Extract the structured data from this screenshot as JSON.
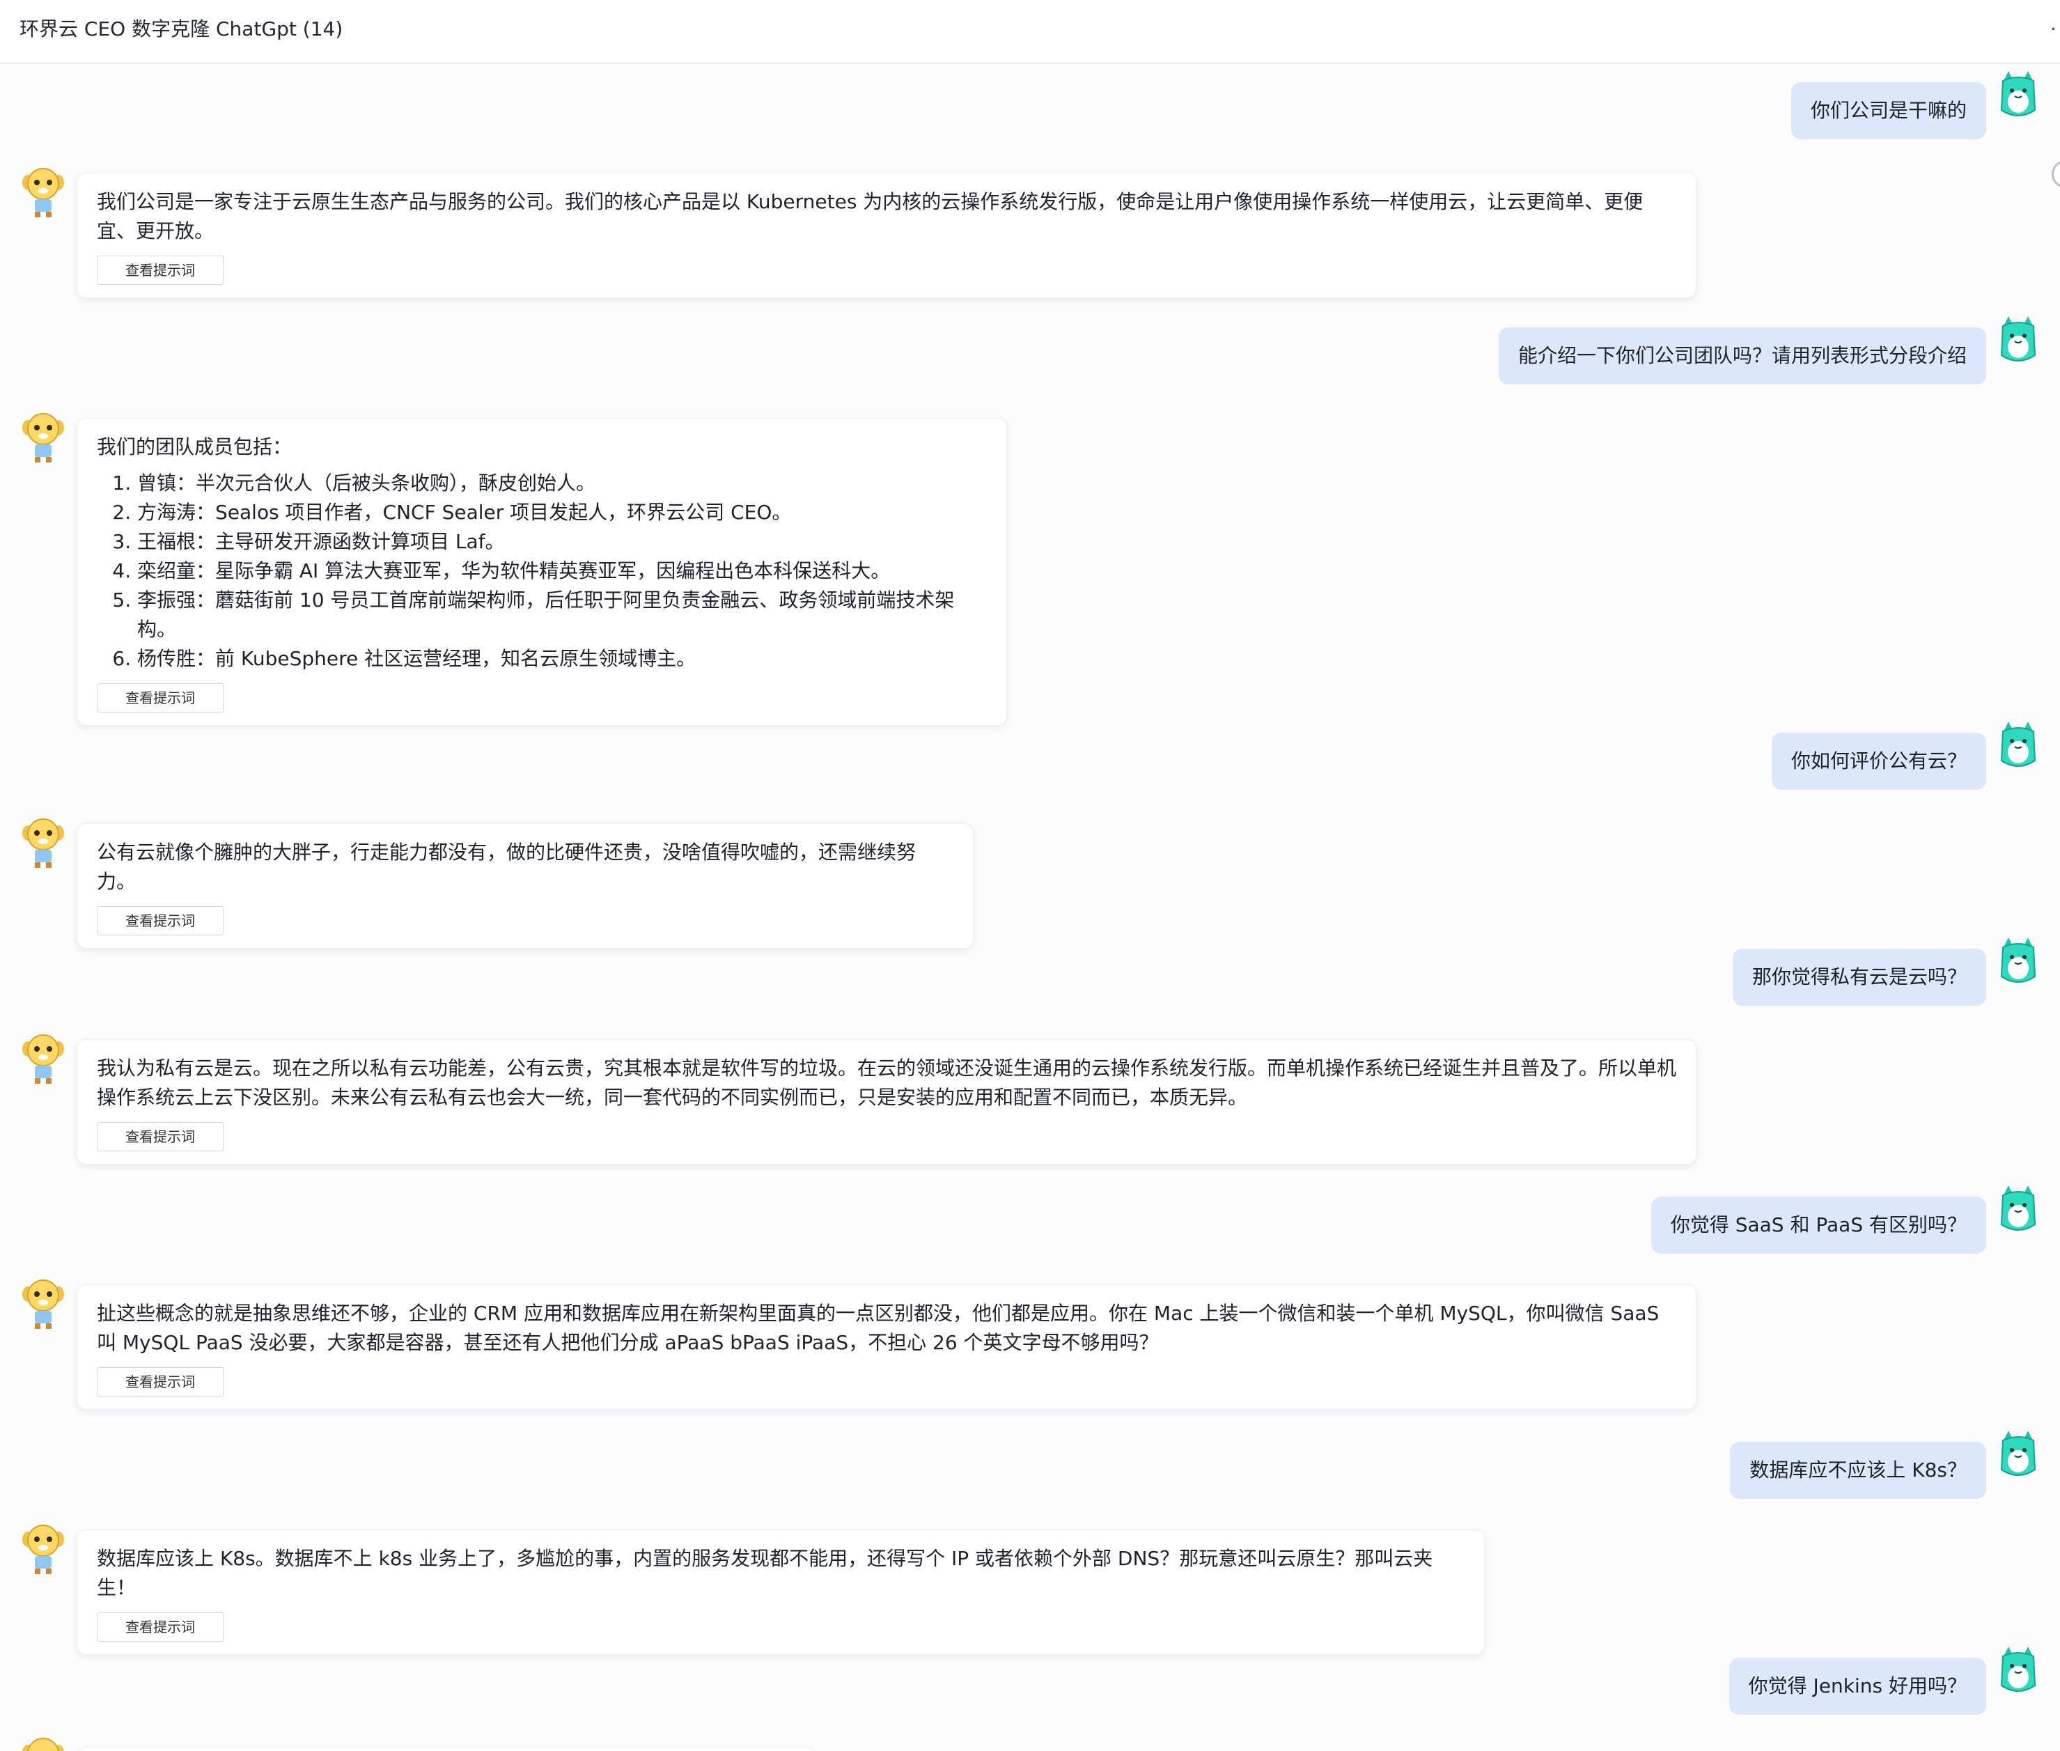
{
  "window": {
    "title": "环界云 CEO 数字克隆 ChatGpt (14)",
    "menu_glyph": "·"
  },
  "messages": [
    {
      "role": "user",
      "text": "你们公司是干嘛的"
    },
    {
      "role": "assistant",
      "text": "我们公司是一家专注于云原生生态产品与服务的公司。我们的核心产品是以 Kubernetes 为内核的云操作系统发行版，使命是让用户像使用操作系统一样使用云，让云更简单、更便宜、更开放。",
      "button": "查看提示词"
    },
    {
      "role": "user",
      "text": "能介绍一下你们公司团队吗？请用列表形式分段介绍"
    },
    {
      "role": "assistant",
      "text": "我们的团队成员包括：",
      "list": [
        "曾镇：半次元合伙人（后被头条收购），酥皮创始人。",
        "方海涛：Sealos 项目作者，CNCF Sealer 项目发起人，环界云公司 CEO。",
        "王福根：主导研发开源函数计算项目 Laf。",
        "栾绍童：星际争霸 AI 算法大赛亚军，华为软件精英赛亚军，因编程出色本科保送科大。",
        "李振强：蘑菇街前 10 号员工首席前端架构师，后任职于阿里负责金融云、政务领域前端技术架构。",
        "杨传胜：前 KubeSphere 社区运营经理，知名云原生领域博主。"
      ],
      "button": "查看提示词"
    },
    {
      "role": "user",
      "text": "你如何评价公有云？"
    },
    {
      "role": "assistant",
      "text": "公有云就像个臃肿的大胖子，行走能力都没有，做的比硬件还贵，没啥值得吹嘘的，还需继续努力。",
      "button": "查看提示词"
    },
    {
      "role": "user",
      "text": "那你觉得私有云是云吗？"
    },
    {
      "role": "assistant",
      "text": "我认为私有云是云。现在之所以私有云功能差，公有云贵，究其根本就是软件写的垃圾。在云的领域还没诞生通用的云操作系统发行版。而单机操作系统已经诞生并且普及了。所以单机操作系统云上云下没区别。未来公有云私有云也会大一统，同一套代码的不同实例而已，只是安装的应用和配置不同而已，本质无异。",
      "button": "查看提示词"
    },
    {
      "role": "user",
      "text": "你觉得 SaaS 和 PaaS 有区别吗？"
    },
    {
      "role": "assistant",
      "text": "扯这些概念的就是抽象思维还不够，企业的 CRM 应用和数据库应用在新架构里面真的一点区别都没，他们都是应用。你在 Mac 上装一个微信和装一个单机 MySQL，你叫微信 SaaS 叫 MySQL PaaS 没必要，大家都是容器，甚至还有人把他们分成 aPaaS bPaaS iPaaS，不担心 26 个英文字母不够用吗？",
      "button": "查看提示词"
    },
    {
      "role": "user",
      "text": "数据库应不应该上 K8s？"
    },
    {
      "role": "assistant",
      "text": "数据库应该上 K8s。数据库不上 k8s 业务上了，多尴尬的事，内置的服务发现都不能用，还得写个 IP 或者依赖个外部 DNS？那玩意还叫云原生？那叫云夹生！",
      "button": "查看提示词"
    },
    {
      "role": "user",
      "text": "你觉得 Jenkins 好用吗？"
    }
  ],
  "colors": {
    "user_bubble": "#dde7fb",
    "assistant_bubble": "#ffffff",
    "page_bg": "#fcfcfd"
  },
  "icons": {
    "assistant_avatar": "bot-avatar-icon",
    "user_avatar": "user-avatar-icon"
  }
}
